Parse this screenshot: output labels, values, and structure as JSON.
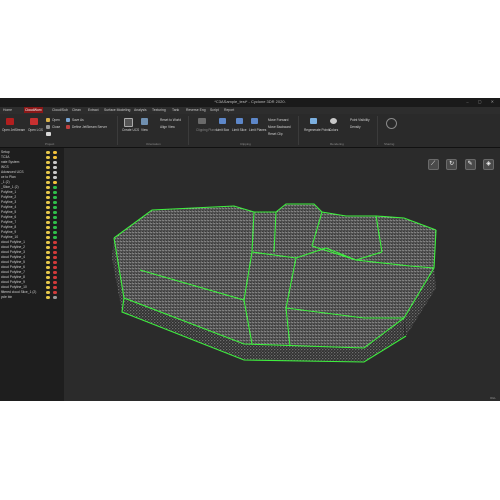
{
  "window": {
    "title": "*C3ASample_test* - Cyclone 3DR 2020.",
    "controls": "–  ▢  ✕"
  },
  "menu": {
    "items": [
      "Home",
      "CloudWorx",
      "Cloud/Sub",
      "Clean",
      "Extract",
      "Surface Modeling",
      "Analysis",
      "Texturing",
      "Tank",
      "Reverse Eng",
      "Script",
      "Report"
    ],
    "active_index": 1
  },
  "ribbon": {
    "open_jetstream": "Open JetStream",
    "open_lgs": "Open LGS",
    "open": "Open",
    "save_as": "Save As",
    "close": "Close",
    "define_jetstream_server": "Define JetStream Server",
    "project_group": "Project",
    "create_ucs": "Create UCS",
    "view": "View",
    "reset_to_world": "Reset to World",
    "align_view": "Align View",
    "orientation_group": "Orientation",
    "clipping_planes": "Clipping Planes",
    "limit_box": "Limit Box",
    "limit_slice": "Limit Slice",
    "limit_planes": "Limit Planes",
    "move_forward": "Move Forward",
    "move_backward": "Move Backward",
    "reset_clip": "Reset Clip",
    "clipping_group": "Clipping",
    "regenerate_points": "Regenerate Points",
    "colors": "Colors",
    "point_visibility": "Point Visibility",
    "density": "Density",
    "rendering_group": "Rendering",
    "sharing_group": "Sharing"
  },
  "tree": {
    "items": [
      {
        "label": "Setup"
      },
      {
        "label": "TC3A"
      },
      {
        "label": "nate System"
      },
      {
        "label": "WCS"
      },
      {
        "label": "Advanced UCS"
      },
      {
        "label": "ce to Plan"
      },
      {
        "label": "_1 (2)"
      },
      {
        "label": "_Slice_1 (2)"
      },
      {
        "label": "Polyline_1"
      },
      {
        "label": "Polyline_2"
      },
      {
        "label": "Polyline_3"
      },
      {
        "label": "Polyline_4"
      },
      {
        "label": "Polyline_5"
      },
      {
        "label": "Polyline_6"
      },
      {
        "label": "Polyline_7"
      },
      {
        "label": "Polyline_8"
      },
      {
        "label": "Polyline_9"
      },
      {
        "label": "Polyline_10"
      },
      {
        "label": "cloud Polyline_1"
      },
      {
        "label": "cloud Polyline_2"
      },
      {
        "label": "cloud Polyline_3"
      },
      {
        "label": "cloud Polyline_4"
      },
      {
        "label": "cloud Polyline_5"
      },
      {
        "label": "cloud Polyline_6"
      },
      {
        "label": "cloud Polyline_7"
      },
      {
        "label": "cloud Polyline_8"
      },
      {
        "label": "cloud Polyline_9"
      },
      {
        "label": "cloud Polyline_10"
      },
      {
        "label": "filtered cloud Slice_1 (2)"
      },
      {
        "label": "ycle bin"
      }
    ]
  },
  "viewport": {
    "status": "REL"
  },
  "colors": {
    "accent": "#8a1818",
    "edge": "#3ef03e",
    "panel": "#1e1e1e",
    "viewport": "#2b2b2b"
  }
}
